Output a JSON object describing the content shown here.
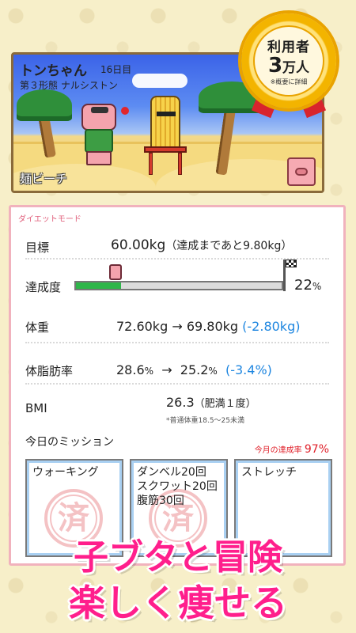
{
  "scene": {
    "character_name": "トンちゃん",
    "day": "16日目",
    "form": "第３形態 ナルシストン",
    "location": "麺ビーチ"
  },
  "badge": {
    "line1": "利用者",
    "line2_num": "3",
    "line2_unit": "万人",
    "line3": "※概要に詳細"
  },
  "diet": {
    "mode_title": "ダイエットモード",
    "goal": {
      "label": "目標",
      "value": "60.00kg",
      "remaining": "（達成まであと9.80kg）"
    },
    "progress": {
      "label": "達成度",
      "value": 22,
      "value_text": "22",
      "unit": "%"
    },
    "weight": {
      "label": "体重",
      "from": "72.60kg",
      "arrow": "→",
      "to": "69.80kg",
      "diff": "(-2.80kg)"
    },
    "body_fat": {
      "label": "体脂肪率",
      "from": "28.6",
      "from_unit": "%",
      "arrow": "→",
      "to": "25.2",
      "to_unit": "%",
      "diff": "(-3.4%)"
    },
    "bmi": {
      "label": "BMI",
      "value": "26.3",
      "category": "（肥満１度）",
      "note": "*普通体重18.5〜25未満"
    },
    "missions": {
      "title": "今日のミッション",
      "monthly_label": "今月の達成率",
      "monthly_value": "97%",
      "items": [
        {
          "text": "ウォーキング",
          "stamp": "済"
        },
        {
          "text": "ダンベル20回\nスクワット20回\n腹筋30回",
          "stamp": "済"
        },
        {
          "text": "ストレッチ",
          "stamp": ""
        }
      ]
    }
  },
  "caption": {
    "line1": "子ブタと冒険",
    "line2": "楽しく痩せる"
  },
  "colors": {
    "accent_pink": "#ff1f8c",
    "progress_green": "#2fb64a",
    "negative_blue": "#1e86e0",
    "monthly_red": "#e0202a"
  },
  "icons": [
    "pig-face-icon",
    "goal-flag-icon",
    "done-stamp-icon"
  ]
}
